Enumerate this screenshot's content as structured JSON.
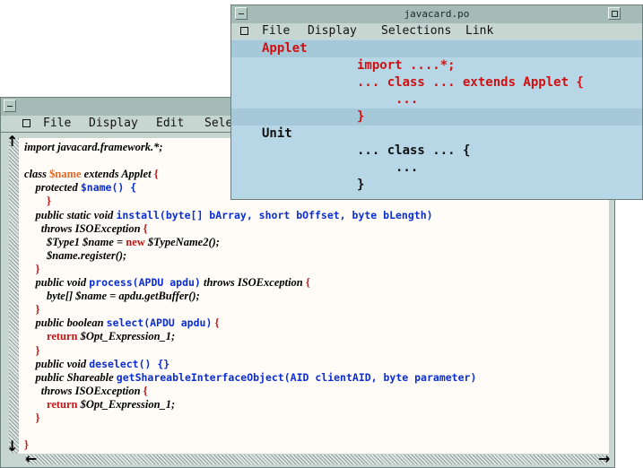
{
  "editor": {
    "menu": [
      "File",
      "Display",
      "Edit",
      "Sele"
    ],
    "code": [
      {
        "parts": [
          {
            "t": "import javacard.framework.*;",
            "c": "plain"
          }
        ]
      },
      {
        "parts": [
          {
            "t": "",
            "c": "plain"
          }
        ]
      },
      {
        "parts": [
          {
            "t": "class ",
            "c": "plain"
          },
          {
            "t": "$name",
            "c": "orange"
          },
          {
            "t": " extends Applet ",
            "c": "plain"
          },
          {
            "t": "{",
            "c": "red"
          }
        ]
      },
      {
        "parts": [
          {
            "t": "    protected ",
            "c": "plain"
          },
          {
            "t": "$name() {",
            "c": "blue"
          }
        ]
      },
      {
        "parts": [
          {
            "t": "        }",
            "c": "red"
          }
        ]
      },
      {
        "parts": [
          {
            "t": "    public static void ",
            "c": "plain"
          },
          {
            "t": "install(byte[] bArray, short bOffset, byte bLength)",
            "c": "blue"
          }
        ]
      },
      {
        "parts": [
          {
            "t": "      throws ISOException ",
            "c": "plain"
          },
          {
            "t": "{",
            "c": "red"
          }
        ]
      },
      {
        "parts": [
          {
            "t": "        $Type1 $name = ",
            "c": "plain"
          },
          {
            "t": "new",
            "c": "red"
          },
          {
            "t": " $TypeName2();",
            "c": "plain"
          }
        ]
      },
      {
        "parts": [
          {
            "t": "        $name.register();",
            "c": "plain"
          }
        ]
      },
      {
        "parts": [
          {
            "t": "    }",
            "c": "red"
          }
        ]
      },
      {
        "parts": [
          {
            "t": "    public void ",
            "c": "plain"
          },
          {
            "t": "process(APDU apdu)",
            "c": "blue"
          },
          {
            "t": " throws ISOException ",
            "c": "plain"
          },
          {
            "t": "{",
            "c": "red"
          }
        ]
      },
      {
        "parts": [
          {
            "t": "        byte[] $name = apdu.getBuffer();",
            "c": "plain"
          }
        ]
      },
      {
        "parts": [
          {
            "t": "    }",
            "c": "red"
          }
        ]
      },
      {
        "parts": [
          {
            "t": "    public boolean ",
            "c": "plain"
          },
          {
            "t": "select(APDU apdu)",
            "c": "blue"
          },
          {
            "t": " {",
            "c": "red"
          }
        ]
      },
      {
        "parts": [
          {
            "t": "        return",
            "c": "red"
          },
          {
            "t": " $Opt_Expression_1;",
            "c": "plain"
          }
        ]
      },
      {
        "parts": [
          {
            "t": "    }",
            "c": "red"
          }
        ]
      },
      {
        "parts": [
          {
            "t": "    public void ",
            "c": "plain"
          },
          {
            "t": "deselect() {}",
            "c": "blue"
          }
        ]
      },
      {
        "parts": [
          {
            "t": "    public Shareable ",
            "c": "plain"
          },
          {
            "t": "getShareableInterfaceObject(AID clientAID, byte parameter)",
            "c": "blue"
          }
        ]
      },
      {
        "parts": [
          {
            "t": "      throws ISOException ",
            "c": "plain"
          },
          {
            "t": "{",
            "c": "red"
          }
        ]
      },
      {
        "parts": [
          {
            "t": "        return",
            "c": "red"
          },
          {
            "t": " $Opt_Expression_1;",
            "c": "plain"
          }
        ]
      },
      {
        "parts": [
          {
            "t": "    }",
            "c": "red"
          }
        ]
      },
      {
        "parts": [
          {
            "t": "",
            "c": "plain"
          }
        ]
      },
      {
        "parts": [
          {
            "t": "}",
            "c": "red"
          }
        ]
      }
    ]
  },
  "po": {
    "title": "javacard.po",
    "menu": [
      "File",
      "Display",
      "Selections",
      "Link"
    ],
    "rows": [
      {
        "text": "Applet",
        "indent": 1,
        "color": "#d01010",
        "hl": true
      },
      {
        "text": "import ....*;",
        "indent": 2,
        "color": "#d01010",
        "hl": false
      },
      {
        "text": "... class ... extends Applet {",
        "indent": 2,
        "color": "#d01010",
        "hl": false
      },
      {
        "text": "...",
        "indent": 3,
        "color": "#d01010",
        "hl": false
      },
      {
        "text": "}",
        "indent": 2,
        "color": "#d01010",
        "hl": true
      },
      {
        "text": "Unit",
        "indent": 1,
        "color": "#111111",
        "hl": false
      },
      {
        "text": "... class ... {",
        "indent": 2,
        "color": "#111111",
        "hl": false
      },
      {
        "text": "...",
        "indent": 3,
        "color": "#111111",
        "hl": false
      },
      {
        "text": "}",
        "indent": 2,
        "color": "#111111",
        "hl": false
      }
    ]
  },
  "icons": {
    "minimize": "minimize-icon",
    "maximize": "maximize-icon",
    "menu_box": "menu-box-icon",
    "arrow_up": "arrow-up-icon",
    "arrow_down": "arrow-down-icon",
    "arrow_left": "arrow-left-icon",
    "arrow_right": "arrow-right-icon"
  }
}
